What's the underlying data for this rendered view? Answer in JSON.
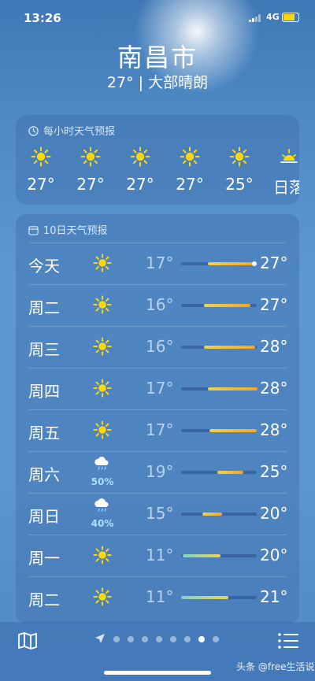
{
  "status": {
    "time": "13:26",
    "network": "4G"
  },
  "location": {
    "city": "南昌市",
    "summary": "27° | 大部晴朗"
  },
  "hourly": {
    "header": "每小时天气预报",
    "items": [
      {
        "temp": "27°",
        "icon": "sun-icon"
      },
      {
        "temp": "27°",
        "icon": "sun-icon"
      },
      {
        "temp": "27°",
        "icon": "sun-icon"
      },
      {
        "temp": "27°",
        "icon": "sun-icon"
      },
      {
        "temp": "25°",
        "icon": "sun-icon"
      },
      {
        "temp": "日落",
        "icon": "sunset-icon"
      }
    ]
  },
  "daily": {
    "header": "10日天气预报",
    "rows": [
      {
        "day": "今天",
        "icon": "sun-icon",
        "pct": "",
        "lo": "17°",
        "hi": "27°",
        "bar": [
          0.35,
          0.6
        ],
        "current": 0.62
      },
      {
        "day": "周二",
        "icon": "sun-icon",
        "pct": "",
        "lo": "16°",
        "hi": "27°",
        "bar": [
          0.3,
          0.62
        ],
        "current": null
      },
      {
        "day": "周三",
        "icon": "sun-icon",
        "pct": "",
        "lo": "16°",
        "hi": "28°",
        "bar": [
          0.3,
          0.68
        ],
        "current": null
      },
      {
        "day": "周四",
        "icon": "sun-icon",
        "pct": "",
        "lo": "17°",
        "hi": "28°",
        "bar": [
          0.35,
          0.66
        ],
        "current": null
      },
      {
        "day": "周五",
        "icon": "sun-icon",
        "pct": "",
        "lo": "17°",
        "hi": "28°",
        "bar": [
          0.38,
          0.62
        ],
        "current": null
      },
      {
        "day": "周六",
        "icon": "rain-cloud-icon",
        "pct": "50%",
        "lo": "19°",
        "hi": "25°",
        "bar": [
          0.48,
          0.34
        ],
        "current": null
      },
      {
        "day": "周日",
        "icon": "rain-cloud-icon",
        "pct": "40%",
        "lo": "15°",
        "hi": "20°",
        "bar": [
          0.28,
          0.26
        ],
        "current": null
      },
      {
        "day": "周一",
        "icon": "sun-icon",
        "pct": "",
        "lo": "11°",
        "hi": "20°",
        "bar": [
          0.02,
          0.5
        ],
        "current": null
      },
      {
        "day": "周二",
        "icon": "sun-icon",
        "pct": "",
        "lo": "11°",
        "hi": "21°",
        "bar": [
          0.0,
          0.62
        ],
        "current": null
      }
    ]
  },
  "watermark": "头条 @free生活说",
  "colors": {
    "warm": "#f5a623",
    "mild": "#f0d24a",
    "cool": "#7fd6c8"
  }
}
